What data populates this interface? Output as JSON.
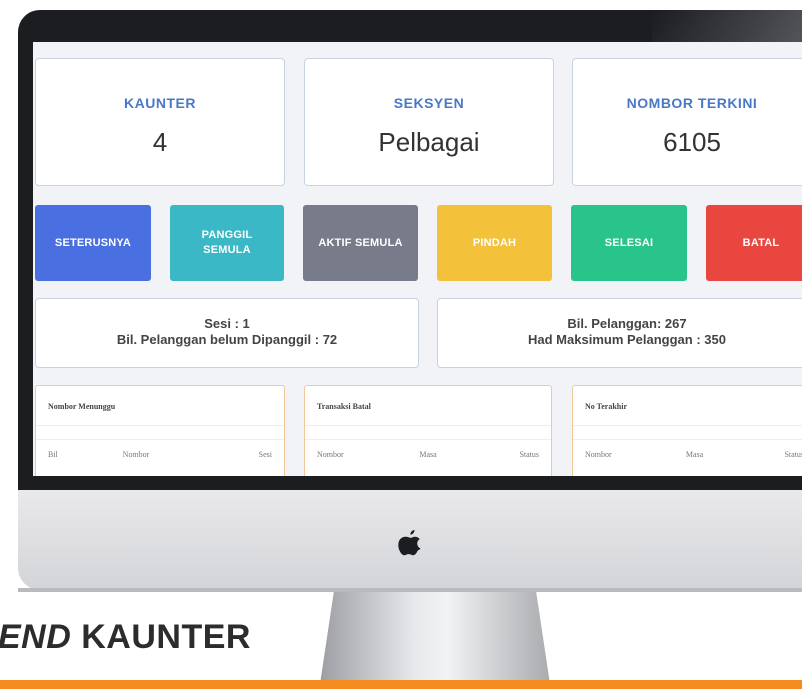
{
  "cards": [
    {
      "label": "KAUNTER",
      "value": "4"
    },
    {
      "label": "SEKSYEN",
      "value": "Pelbagai"
    },
    {
      "label": "NOMBOR TERKINI",
      "value": "6105"
    }
  ],
  "buttons": [
    {
      "label": "SETERUSNYA",
      "color": "#4a6fe0"
    },
    {
      "label": "PANGGIL SEMULA",
      "color": "#3bb8c6"
    },
    {
      "label": "AKTIF SEMULA",
      "color": "#787b8a"
    },
    {
      "label": "PINDAH",
      "color": "#f4c13a"
    },
    {
      "label": "SELESAI",
      "color": "#29c48a"
    },
    {
      "label": "BATAL",
      "color": "#e8463f"
    }
  ],
  "session": {
    "sesi": "Sesi : 1",
    "belum_dipanggil": "Bil. Pelanggan belum Dipanggil : 72",
    "bil_pelanggan": "Bil. Pelanggan: 267",
    "had_maksimum": "Had Maksimum Pelanggan : 350"
  },
  "tables": [
    {
      "title": "Nombor Menunggu",
      "columns": [
        "Bil",
        "Nombor",
        "Sesi"
      ]
    },
    {
      "title": "Transaksi Batal",
      "columns": [
        "Nombor",
        "Masa",
        "Status"
      ]
    },
    {
      "title": "No Terakhir",
      "columns": [
        "Nombor",
        "Masa",
        "Status"
      ]
    }
  ],
  "caption": {
    "prefix": "END",
    "suffix": " KAUNTER"
  },
  "icons": {
    "monitor_logo": "apple-logo-icon"
  },
  "colors": {
    "accent": "#4a78c8",
    "brand_bar": "#f48c1f"
  }
}
